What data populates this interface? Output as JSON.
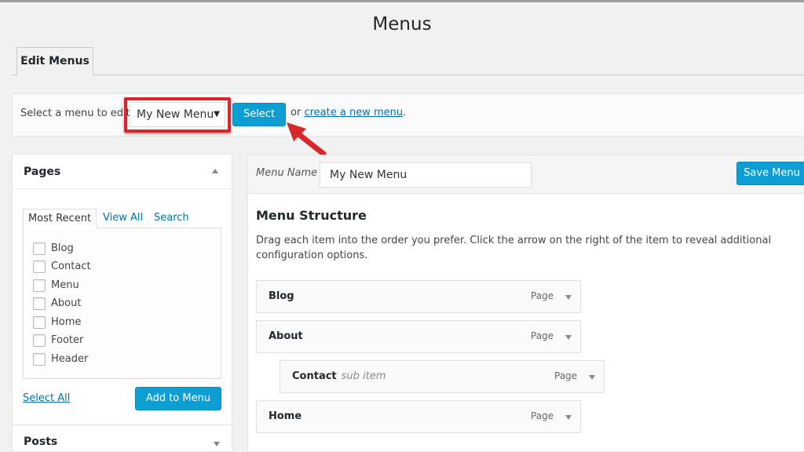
{
  "page": {
    "title": "Menus"
  },
  "tabs": {
    "edit_menus": "Edit Menus"
  },
  "manage": {
    "label": "Select a menu to edit:",
    "selected_menu": "My New Menu",
    "select_button": "Select",
    "or_text": "or",
    "create_link": "create a new menu",
    "period": "."
  },
  "pages_box": {
    "title": "Pages",
    "tabs": [
      "Most Recent",
      "View All",
      "Search"
    ],
    "items": [
      "Blog",
      "Contact",
      "Menu",
      "About",
      "Home",
      "Footer",
      "Header"
    ],
    "select_all": "Select All",
    "add_button": "Add to Menu"
  },
  "posts_box": {
    "title": "Posts"
  },
  "editor": {
    "menu_name_label": "Menu Name",
    "menu_name_value": "My New Menu",
    "save_button": "Save Menu",
    "structure_title": "Menu Structure",
    "structure_desc": "Drag each item into the order you prefer. Click the arrow on the right of the item to reveal additional configuration options.",
    "items": [
      {
        "title": "Blog",
        "sub": "",
        "type": "Page"
      },
      {
        "title": "About",
        "sub": "",
        "type": "Page"
      },
      {
        "title": "Contact",
        "sub": "sub item",
        "type": "Page"
      },
      {
        "title": "Home",
        "sub": "",
        "type": "Page"
      }
    ]
  },
  "colors": {
    "accent": "#0d9fd3",
    "highlight": "#d8262a",
    "link": "#0073aa"
  }
}
